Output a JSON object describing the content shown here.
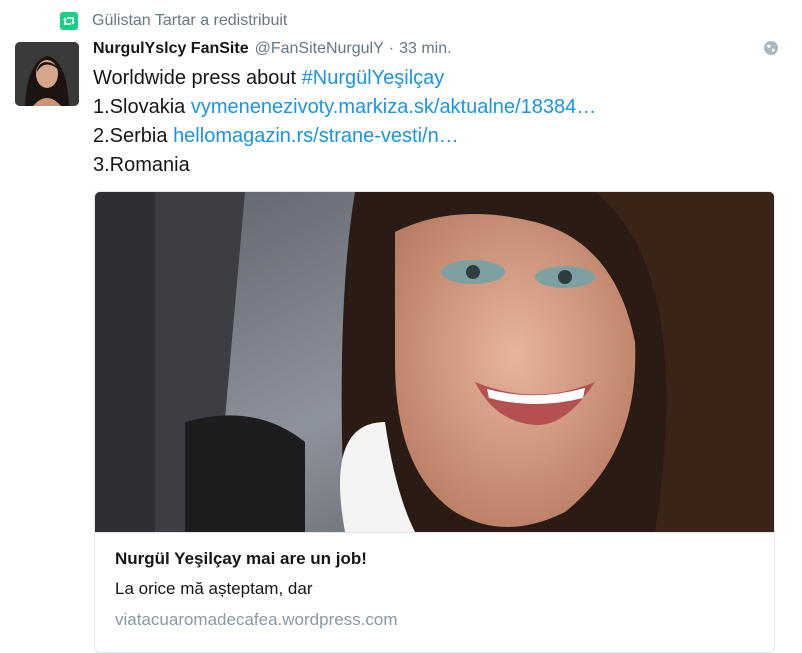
{
  "retweet": {
    "icon": "retweet-icon",
    "text": "Gülistan Tartar a redistribuit"
  },
  "tweet": {
    "author_name": "NurgulYslcy FanSite",
    "handle": "@FanSiteNurgulY",
    "separator": "·",
    "time": "33 min.",
    "lines": {
      "l1_text": "Worldwide press about ",
      "l1_hashtag": "#NurgülYeşilçay",
      "l2_text": "1.Slovakia ",
      "l2_link": "vymenenezivoty.markiza.sk/aktualne/18384…",
      "l3_text": "2.Serbia ",
      "l3_link": "hellomagazin.rs/strane-vesti/n…",
      "l4_text": "3.Romania"
    }
  },
  "card": {
    "title": "Nurgül Yeşilçay mai are un job!",
    "description": "La orice mă așteptam, dar",
    "domain": "viatacuaromadecafea.wordpress.com"
  },
  "colors": {
    "link": "#1b95e0",
    "retweet_green": "#19cf86",
    "muted": "#657786"
  }
}
